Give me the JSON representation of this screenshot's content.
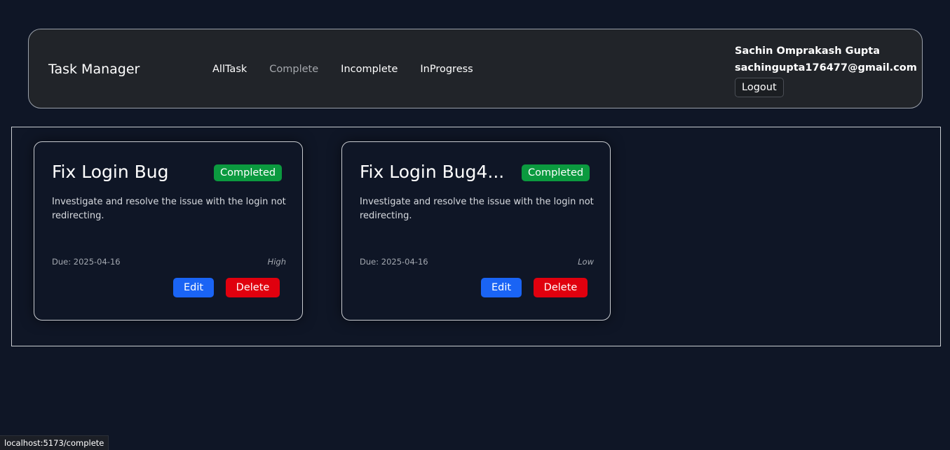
{
  "navbar": {
    "brand": "Task Manager",
    "links": [
      {
        "label": "AllTask",
        "active": false
      },
      {
        "label": "Complete",
        "active": true
      },
      {
        "label": "Incomplete",
        "active": false
      },
      {
        "label": "InProgress",
        "active": false
      }
    ],
    "user": {
      "name": "Sachin Omprakash Gupta",
      "email": "sachingupta176477@gmail.com",
      "logout_label": "Logout"
    }
  },
  "tasks": [
    {
      "title": "Fix Login Bug",
      "status": "Completed",
      "description": "Investigate and resolve the issue with the login not redirecting.",
      "due": "Due: 2025-04-16",
      "priority": "High",
      "edit_label": "Edit",
      "delete_label": "Delete"
    },
    {
      "title": "Fix Login Bug4...",
      "status": "Completed",
      "description": "Investigate and resolve the issue with the login not redirecting.",
      "due": "Due: 2025-04-16",
      "priority": "Low",
      "edit_label": "Edit",
      "delete_label": "Delete"
    }
  ],
  "statusbar": {
    "url": "localhost:5173/complete"
  },
  "colors": {
    "background": "#0f1626",
    "navbar_bg": "#212429",
    "badge_completed": "#0b9a3f",
    "edit_button": "#1a64f5",
    "delete_button": "#e0000e"
  }
}
